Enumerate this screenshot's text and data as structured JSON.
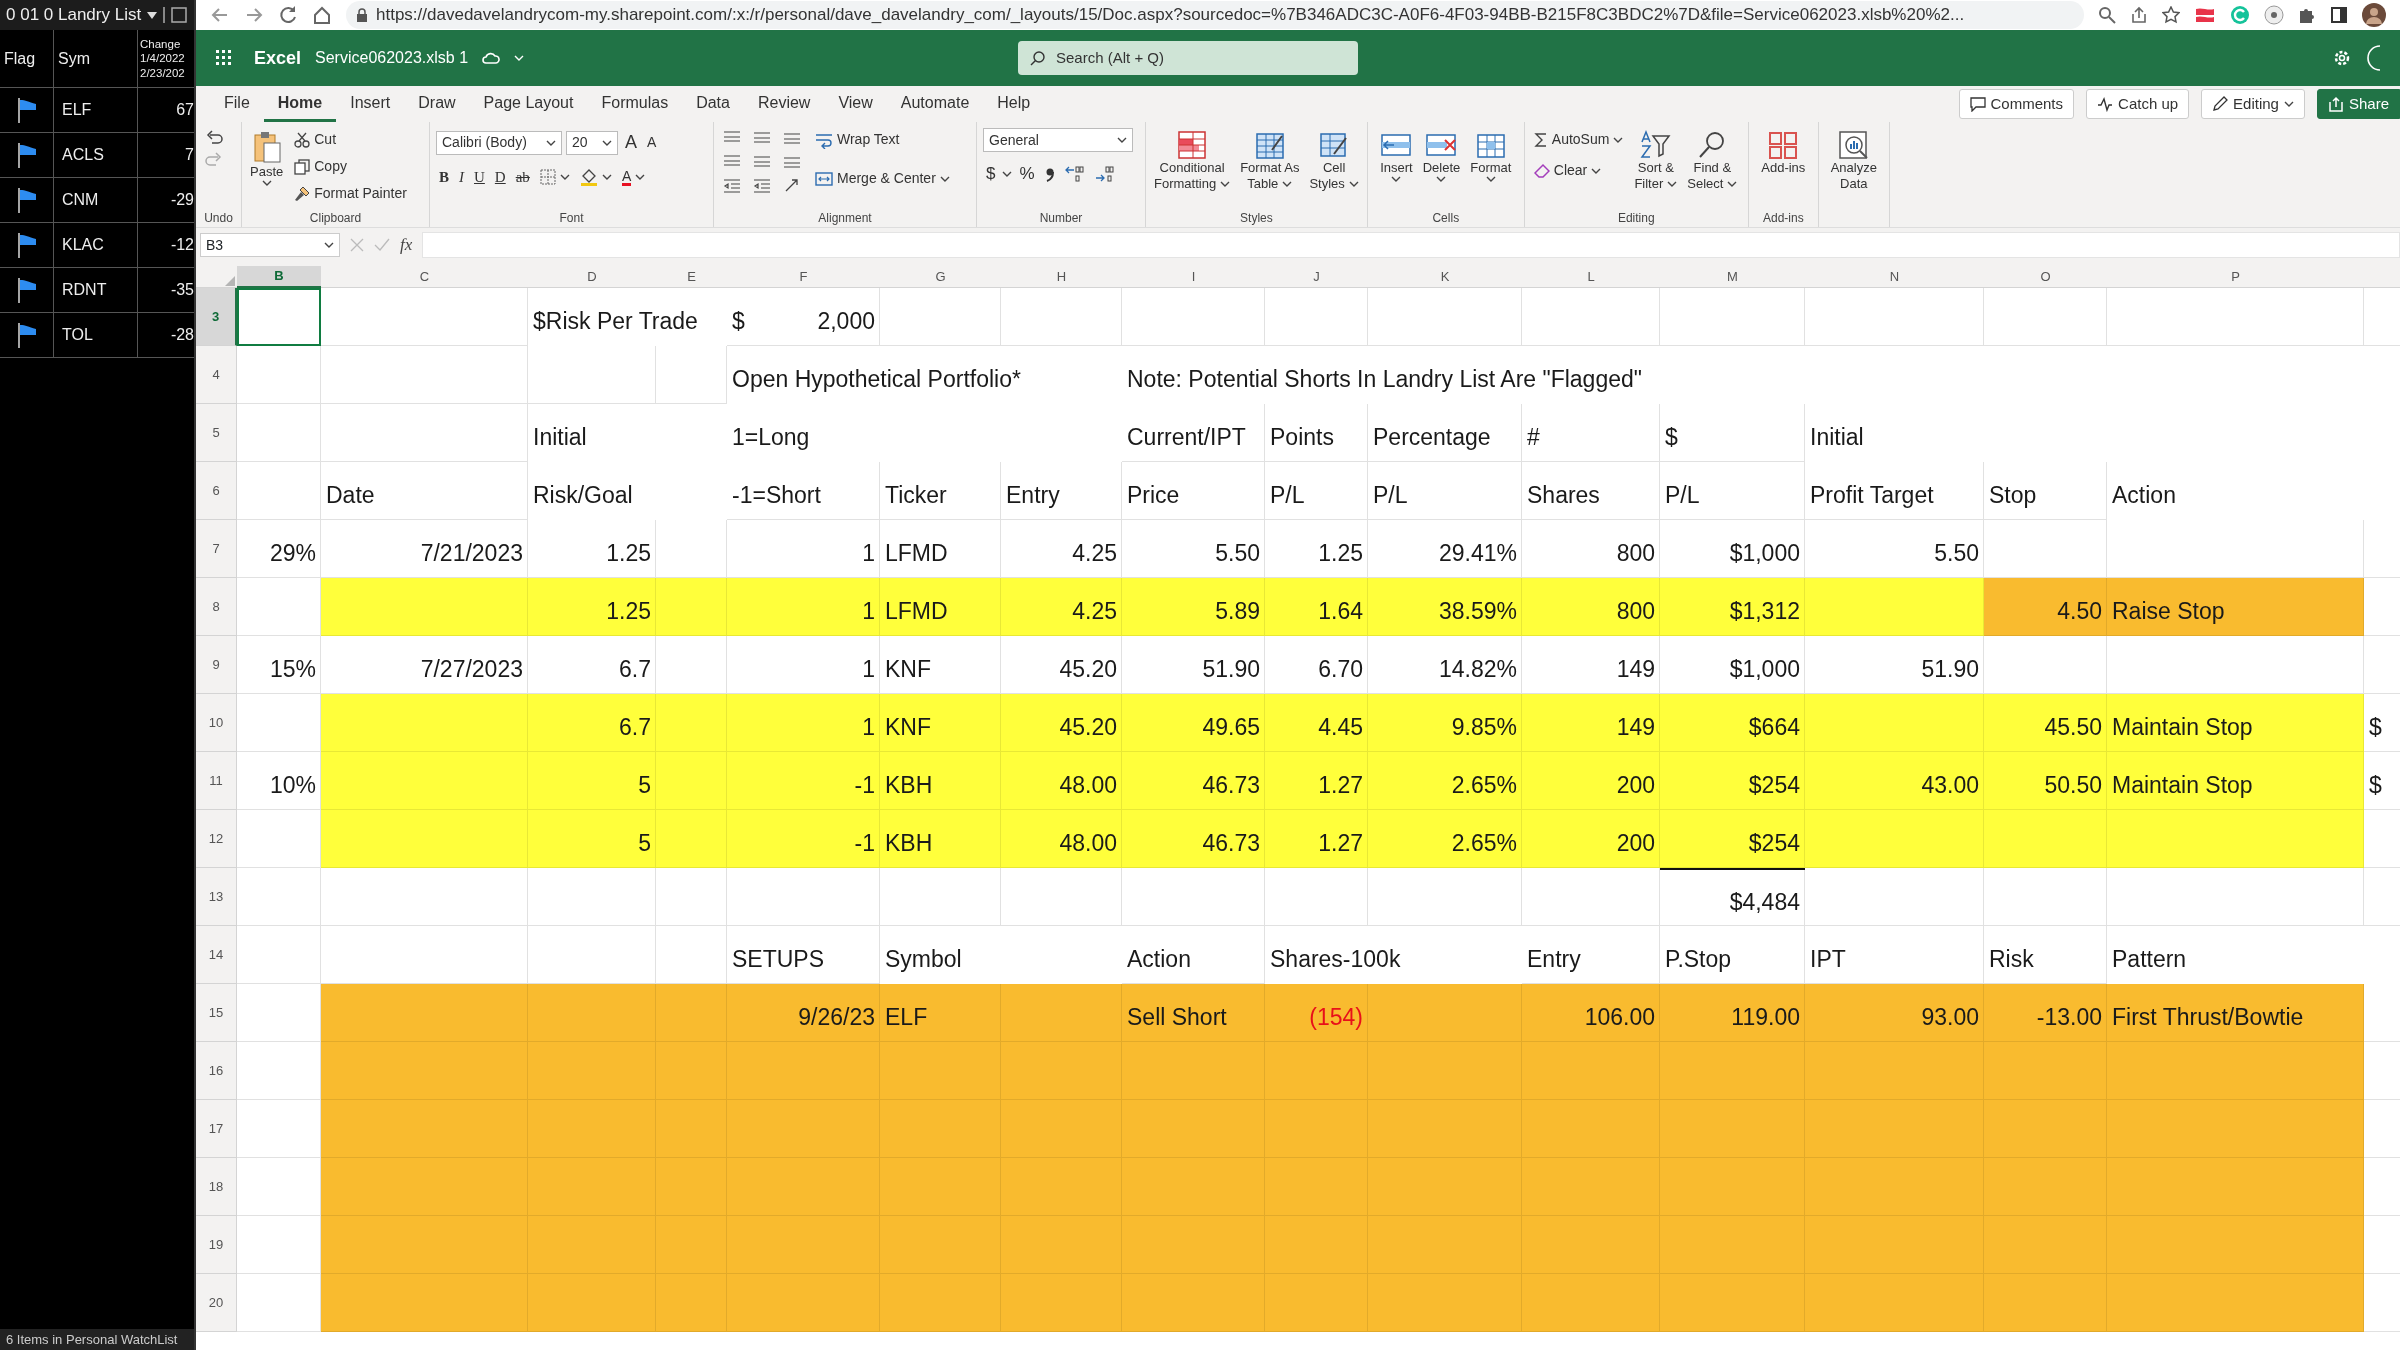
{
  "watchlist": {
    "title": "0 01 0 Landry List",
    "columns": [
      "Flag",
      "Sym"
    ],
    "change_header": [
      "Change",
      "1/4/2022",
      "2/23/202"
    ],
    "rows": [
      {
        "flagged": true,
        "symbol": "ELF",
        "change": "67"
      },
      {
        "flagged": true,
        "symbol": "ACLS",
        "change": "7"
      },
      {
        "flagged": true,
        "symbol": "CNM",
        "change": "-29"
      },
      {
        "flagged": true,
        "symbol": "KLAC",
        "change": "-12"
      },
      {
        "flagged": true,
        "symbol": "RDNT",
        "change": "-35"
      },
      {
        "flagged": true,
        "symbol": "TOL",
        "change": "-28"
      }
    ],
    "footer": "6 Items in Personal WatchList"
  },
  "browser": {
    "url": "https://davedavelandrycom-my.sharepoint.com/:x:/r/personal/dave_davelandry_com/_layouts/15/Doc.aspx?sourcedoc=%7B346ADC3C-A0F6-4F03-94BB-B215F8C3BDC2%7D&file=Service062023.xlsb%20%2..."
  },
  "app": {
    "name": "Excel",
    "file": "Service062023.xlsb 1",
    "search_placeholder": "Search (Alt + Q)"
  },
  "tabs": [
    {
      "label": "File",
      "selected": false
    },
    {
      "label": "Home",
      "selected": true
    },
    {
      "label": "Insert",
      "selected": false
    },
    {
      "label": "Draw",
      "selected": false
    },
    {
      "label": "Page Layout",
      "selected": false
    },
    {
      "label": "Formulas",
      "selected": false
    },
    {
      "label": "Data",
      "selected": false
    },
    {
      "label": "Review",
      "selected": false
    },
    {
      "label": "View",
      "selected": false
    },
    {
      "label": "Automate",
      "selected": false
    },
    {
      "label": "Help",
      "selected": false
    }
  ],
  "header_buttons": [
    {
      "label": "Comments",
      "kind": "comments"
    },
    {
      "label": "Catch up",
      "kind": "catchup"
    },
    {
      "label": "Editing",
      "kind": "editing"
    },
    {
      "label": "Share",
      "kind": "share"
    }
  ],
  "ribbon": [
    {
      "kind": "undo",
      "label": "Undo"
    },
    {
      "kind": "clipboard",
      "label": "Clipboard",
      "paste": "Paste",
      "cut": "Cut",
      "copy": "Copy",
      "painter": "Format Painter"
    },
    {
      "kind": "font",
      "label": "Font",
      "family": "Calibri (Body)",
      "size": "20",
      "grow": "A",
      "shrink": "A",
      "styles": [
        "B",
        "I",
        "U",
        "D",
        "ab"
      ],
      "color_letter": "A"
    },
    {
      "kind": "alignment",
      "label": "Alignment",
      "wrap": "Wrap Text",
      "merge": "Merge & Center"
    },
    {
      "kind": "number",
      "label": "Number",
      "format": "General",
      "symbols": [
        "$",
        "%"
      ]
    },
    {
      "kind": "styles",
      "label": "Styles",
      "buttons": [
        [
          "Conditional",
          "Formatting"
        ],
        [
          "Format As",
          "Table"
        ],
        [
          "Cell",
          "Styles"
        ]
      ]
    },
    {
      "kind": "cells",
      "label": "Cells",
      "buttons": [
        "Insert",
        "Delete",
        "Format"
      ]
    },
    {
      "kind": "editing",
      "label": "Editing",
      "autosum": "AutoSum",
      "clear": "Clear",
      "buttons": [
        [
          "Sort &",
          "Filter"
        ],
        [
          "Find &",
          "Select"
        ]
      ]
    },
    {
      "kind": "addins",
      "label": "Add-ins",
      "buttons": [
        [
          "Add-ins"
        ]
      ]
    },
    {
      "kind": "analyze",
      "buttons": [
        [
          "Analyze",
          "Data"
        ]
      ]
    }
  ],
  "formula_bar": {
    "name_box": "B3",
    "fx": "fx"
  },
  "sheet": {
    "columns": [
      {
        "label": "B",
        "selected": true
      },
      {
        "label": "C",
        "selected": false
      },
      {
        "label": "D",
        "selected": false
      },
      {
        "label": "E",
        "selected": false
      },
      {
        "label": "F",
        "selected": false
      },
      {
        "label": "G",
        "selected": false
      },
      {
        "label": "H",
        "selected": false
      },
      {
        "label": "I",
        "selected": false
      },
      {
        "label": "J",
        "selected": false
      },
      {
        "label": "K",
        "selected": false
      },
      {
        "label": "L",
        "selected": false
      },
      {
        "label": "M",
        "selected": false
      },
      {
        "label": "N",
        "selected": false
      },
      {
        "label": "O",
        "selected": false
      },
      {
        "label": "P",
        "selected": false
      },
      {
        "selected": false
      }
    ],
    "rows": [
      {
        "number": "3",
        "selected": true,
        "cells": [
          null,
          null,
          {
            "text": "$Risk Per Trade",
            "kind": "text"
          },
          null,
          {
            "kind": "accounting",
            "symbol": "$",
            "text": "2,000"
          },
          null,
          null,
          null,
          null,
          null,
          null,
          null,
          null,
          null,
          null,
          null
        ]
      },
      {
        "number": "4",
        "selected": false,
        "cells": [
          null,
          null,
          null,
          null,
          {
            "text": "Open Hypothetical Portfolio*",
            "kind": "text"
          },
          null,
          null,
          {
            "text": "Note: Potential Shorts In Landry List Are \"Flagged\"",
            "kind": "text"
          },
          null,
          null,
          null,
          null,
          null,
          null,
          null,
          null
        ]
      },
      {
        "number": "5",
        "selected": false,
        "cells": [
          null,
          null,
          {
            "text": "Initial",
            "kind": "text"
          },
          null,
          {
            "text": "1=Long",
            "kind": "text"
          },
          null,
          null,
          {
            "text": "Current/IPT",
            "kind": "text"
          },
          {
            "text": "Points",
            "kind": "text"
          },
          {
            "text": "Percentage",
            "kind": "text"
          },
          {
            "text": "#",
            "kind": "text"
          },
          {
            "text": "$",
            "kind": "text"
          },
          {
            "text": "Initial",
            "kind": "text"
          },
          null,
          null,
          null
        ]
      },
      {
        "number": "6",
        "selected": false,
        "cells": [
          null,
          {
            "text": "Date",
            "kind": "text"
          },
          {
            "text": "Risk/Goal",
            "kind": "text"
          },
          null,
          {
            "text": "-1=Short",
            "kind": "text"
          },
          {
            "text": "Ticker",
            "kind": "text"
          },
          {
            "text": "Entry",
            "kind": "text"
          },
          {
            "text": "Price",
            "kind": "text"
          },
          {
            "text": "P/L",
            "kind": "text"
          },
          {
            "text": "P/L",
            "kind": "text"
          },
          {
            "text": "Shares",
            "kind": "text"
          },
          {
            "text": "P/L",
            "kind": "text"
          },
          {
            "text": "Profit Target",
            "kind": "text"
          },
          {
            "text": "Stop",
            "kind": "text"
          },
          {
            "text": "Action",
            "kind": "text"
          },
          null
        ]
      },
      {
        "number": "7",
        "selected": false,
        "cells": [
          {
            "text": "29%",
            "kind": "number"
          },
          {
            "text": "7/21/2023",
            "kind": "number"
          },
          {
            "text": "1.25",
            "kind": "number"
          },
          null,
          {
            "text": "1",
            "kind": "number"
          },
          {
            "text": "LFMD",
            "kind": "text"
          },
          {
            "text": "4.25",
            "kind": "number"
          },
          {
            "text": "5.50",
            "kind": "number"
          },
          {
            "text": "1.25",
            "kind": "number"
          },
          {
            "text": "29.41%",
            "kind": "number"
          },
          {
            "text": "800",
            "kind": "number"
          },
          {
            "text": "$1,000",
            "kind": "number"
          },
          {
            "text": "5.50",
            "kind": "number"
          },
          null,
          null,
          null
        ]
      },
      {
        "number": "8",
        "selected": false,
        "cells": [
          null,
          {
            "color": "#ffff3b"
          },
          {
            "text": "1.25",
            "kind": "number",
            "color": "#ffff3b"
          },
          {
            "color": "#ffff3b"
          },
          {
            "text": "1",
            "kind": "number",
            "color": "#ffff3b"
          },
          {
            "text": "LFMD",
            "kind": "text",
            "color": "#ffff3b"
          },
          {
            "text": "4.25",
            "kind": "number",
            "color": "#ffff3b"
          },
          {
            "text": "5.89",
            "kind": "number",
            "color": "#ffff3b"
          },
          {
            "text": "1.64",
            "kind": "number",
            "color": "#ffff3b"
          },
          {
            "text": "38.59%",
            "kind": "number",
            "color": "#ffff3b"
          },
          {
            "text": "800",
            "kind": "number",
            "color": "#ffff3b"
          },
          {
            "text": "$1,312",
            "kind": "number",
            "color": "#ffff3b"
          },
          {
            "color": "#ffff3b"
          },
          {
            "text": "4.50",
            "kind": "number",
            "color": "#f9bb2f"
          },
          {
            "text": "Raise Stop",
            "kind": "text",
            "color": "#f9bb2f"
          },
          null
        ]
      },
      {
        "number": "9",
        "selected": false,
        "cells": [
          {
            "text": "15%",
            "kind": "number"
          },
          {
            "text": "7/27/2023",
            "kind": "number"
          },
          {
            "text": "6.7",
            "kind": "number"
          },
          null,
          {
            "text": "1",
            "kind": "number"
          },
          {
            "text": "KNF",
            "kind": "text"
          },
          {
            "text": "45.20",
            "kind": "number"
          },
          {
            "text": "51.90",
            "kind": "number"
          },
          {
            "text": "6.70",
            "kind": "number"
          },
          {
            "text": "14.82%",
            "kind": "number"
          },
          {
            "text": "149",
            "kind": "number"
          },
          {
            "text": "$1,000",
            "kind": "number"
          },
          {
            "text": "51.90",
            "kind": "number"
          },
          null,
          null,
          null
        ]
      },
      {
        "number": "10",
        "selected": false,
        "cells": [
          null,
          {
            "color": "#ffff3b"
          },
          {
            "text": "6.7",
            "kind": "number",
            "color": "#ffff3b"
          },
          {
            "color": "#ffff3b"
          },
          {
            "text": "1",
            "kind": "number",
            "color": "#ffff3b"
          },
          {
            "text": "KNF",
            "kind": "text",
            "color": "#ffff3b"
          },
          {
            "text": "45.20",
            "kind": "number",
            "color": "#ffff3b"
          },
          {
            "text": "49.65",
            "kind": "number",
            "color": "#ffff3b"
          },
          {
            "text": "4.45",
            "kind": "number",
            "color": "#ffff3b"
          },
          {
            "text": "9.85%",
            "kind": "number",
            "color": "#ffff3b"
          },
          {
            "text": "149",
            "kind": "number",
            "color": "#ffff3b"
          },
          {
            "text": "$664",
            "kind": "number",
            "color": "#ffff3b"
          },
          {
            "color": "#ffff3b"
          },
          {
            "text": "45.50",
            "kind": "number",
            "color": "#ffff3b"
          },
          {
            "text": "Maintain Stop",
            "kind": "text",
            "color": "#ffff3b"
          },
          {
            "text": "$",
            "kind": "text"
          }
        ]
      },
      {
        "number": "11",
        "selected": false,
        "cells": [
          {
            "text": "10%",
            "kind": "number"
          },
          {
            "color": "#ffff3b"
          },
          {
            "text": "5",
            "kind": "number",
            "color": "#ffff3b"
          },
          {
            "color": "#ffff3b"
          },
          {
            "text": "-1",
            "kind": "number",
            "color": "#ffff3b"
          },
          {
            "text": "KBH",
            "kind": "text",
            "color": "#ffff3b"
          },
          {
            "text": "48.00",
            "kind": "number",
            "color": "#ffff3b"
          },
          {
            "text": "46.73",
            "kind": "number",
            "color": "#ffff3b"
          },
          {
            "text": "1.27",
            "kind": "number",
            "color": "#ffff3b"
          },
          {
            "text": "2.65%",
            "kind": "number",
            "color": "#ffff3b"
          },
          {
            "text": "200",
            "kind": "number",
            "color": "#ffff3b"
          },
          {
            "text": "$254",
            "kind": "number",
            "color": "#ffff3b"
          },
          {
            "text": "43.00",
            "kind": "number",
            "color": "#ffff3b"
          },
          {
            "text": "50.50",
            "kind": "number",
            "color": "#ffff3b"
          },
          {
            "text": "Maintain Stop",
            "kind": "text",
            "color": "#ffff3b"
          },
          {
            "text": "$",
            "kind": "text"
          }
        ]
      },
      {
        "number": "12",
        "selected": false,
        "cells": [
          null,
          {
            "color": "#ffff3b"
          },
          {
            "text": "5",
            "kind": "number",
            "color": "#ffff3b"
          },
          {
            "color": "#ffff3b"
          },
          {
            "text": "-1",
            "kind": "number",
            "color": "#ffff3b"
          },
          {
            "text": "KBH",
            "kind": "text",
            "color": "#ffff3b"
          },
          {
            "text": "48.00",
            "kind": "number",
            "color": "#ffff3b"
          },
          {
            "text": "46.73",
            "kind": "number",
            "color": "#ffff3b"
          },
          {
            "text": "1.27",
            "kind": "number",
            "color": "#ffff3b"
          },
          {
            "text": "2.65%",
            "kind": "number",
            "color": "#ffff3b"
          },
          {
            "text": "200",
            "kind": "number",
            "color": "#ffff3b"
          },
          {
            "text": "$254",
            "kind": "number",
            "color": "#ffff3b"
          },
          {
            "color": "#ffff3b"
          },
          {
            "color": "#ffff3b"
          },
          {
            "color": "#ffff3b"
          },
          null
        ]
      },
      {
        "number": "13",
        "selected": false,
        "cells": [
          null,
          null,
          null,
          null,
          null,
          null,
          null,
          null,
          null,
          null,
          null,
          {
            "text": "$4,484",
            "kind": "number",
            "border_top": true
          },
          null,
          null,
          null,
          null
        ]
      },
      {
        "number": "14",
        "selected": false,
        "cells": [
          null,
          null,
          null,
          null,
          {
            "text": "SETUPS",
            "kind": "text"
          },
          {
            "text": "Symbol",
            "kind": "text"
          },
          null,
          {
            "text": "Action",
            "kind": "text"
          },
          {
            "text": "Shares-100k",
            "kind": "text"
          },
          null,
          {
            "text": "Entry",
            "kind": "text"
          },
          {
            "text": "P.Stop",
            "kind": "text"
          },
          {
            "text": "IPT",
            "kind": "text"
          },
          {
            "text": "Risk",
            "kind": "text"
          },
          {
            "text": "Pattern",
            "kind": "text"
          },
          null
        ]
      },
      {
        "number": "15",
        "selected": false,
        "cells": [
          null,
          {
            "color": "#f9bb2f"
          },
          {
            "color": "#f9bb2f"
          },
          {
            "color": "#f9bb2f"
          },
          {
            "text": "9/26/23",
            "kind": "number",
            "color": "#f9bb2f"
          },
          {
            "text": "ELF",
            "kind": "text",
            "color": "#f9bb2f"
          },
          {
            "color": "#f9bb2f"
          },
          {
            "text": "Sell Short",
            "kind": "text",
            "color": "#f9bb2f"
          },
          {
            "text": "(154)",
            "kind": "number",
            "color": "#f9bb2f",
            "negative": true
          },
          {
            "color": "#f9bb2f"
          },
          {
            "text": "106.00",
            "kind": "number",
            "color": "#f9bb2f"
          },
          {
            "text": "119.00",
            "kind": "number",
            "color": "#f9bb2f"
          },
          {
            "text": "93.00",
            "kind": "number",
            "color": "#f9bb2f"
          },
          {
            "text": "-13.00",
            "kind": "number",
            "color": "#f9bb2f"
          },
          {
            "text": "First Thrust/Bowtie",
            "kind": "text",
            "color": "#f9bb2f"
          },
          null
        ]
      },
      {
        "number": "16",
        "selected": false,
        "cells": [
          null,
          {
            "color": "#f9bb2f"
          },
          {
            "color": "#f9bb2f"
          },
          {
            "color": "#f9bb2f"
          },
          {
            "color": "#f9bb2f"
          },
          {
            "color": "#f9bb2f"
          },
          {
            "color": "#f9bb2f"
          },
          {
            "color": "#f9bb2f"
          },
          {
            "color": "#f9bb2f"
          },
          {
            "color": "#f9bb2f"
          },
          {
            "color": "#f9bb2f"
          },
          {
            "color": "#f9bb2f"
          },
          {
            "color": "#f9bb2f"
          },
          {
            "color": "#f9bb2f"
          },
          {
            "color": "#f9bb2f"
          },
          null
        ]
      },
      {
        "number": "17",
        "selected": false,
        "cells": [
          null,
          {
            "color": "#f9bb2f"
          },
          {
            "color": "#f9bb2f"
          },
          {
            "color": "#f9bb2f"
          },
          {
            "color": "#f9bb2f"
          },
          {
            "color": "#f9bb2f"
          },
          {
            "color": "#f9bb2f"
          },
          {
            "color": "#f9bb2f"
          },
          {
            "color": "#f9bb2f"
          },
          {
            "color": "#f9bb2f"
          },
          {
            "color": "#f9bb2f"
          },
          {
            "color": "#f9bb2f"
          },
          {
            "color": "#f9bb2f"
          },
          {
            "color": "#f9bb2f"
          },
          {
            "color": "#f9bb2f"
          },
          null
        ]
      },
      {
        "number": "18",
        "selected": false,
        "cells": [
          null,
          {
            "color": "#f9bb2f"
          },
          {
            "color": "#f9bb2f"
          },
          {
            "color": "#f9bb2f"
          },
          {
            "color": "#f9bb2f"
          },
          {
            "color": "#f9bb2f"
          },
          {
            "color": "#f9bb2f"
          },
          {
            "color": "#f9bb2f"
          },
          {
            "color": "#f9bb2f"
          },
          {
            "color": "#f9bb2f"
          },
          {
            "color": "#f9bb2f"
          },
          {
            "color": "#f9bb2f"
          },
          {
            "color": "#f9bb2f"
          },
          {
            "color": "#f9bb2f"
          },
          {
            "color": "#f9bb2f"
          },
          null
        ]
      },
      {
        "number": "19",
        "selected": false,
        "cells": [
          null,
          {
            "color": "#f9bb2f"
          },
          {
            "color": "#f9bb2f"
          },
          {
            "color": "#f9bb2f"
          },
          {
            "color": "#f9bb2f"
          },
          {
            "color": "#f9bb2f"
          },
          {
            "color": "#f9bb2f"
          },
          {
            "color": "#f9bb2f"
          },
          {
            "color": "#f9bb2f"
          },
          {
            "color": "#f9bb2f"
          },
          {
            "color": "#f9bb2f"
          },
          {
            "color": "#f9bb2f"
          },
          {
            "color": "#f9bb2f"
          },
          {
            "color": "#f9bb2f"
          },
          {
            "color": "#f9bb2f"
          },
          null
        ]
      },
      {
        "number": "20",
        "selected": false,
        "cells": [
          null,
          {
            "color": "#f9bb2f"
          },
          {
            "color": "#f9bb2f"
          },
          {
            "color": "#f9bb2f"
          },
          {
            "color": "#f9bb2f"
          },
          {
            "color": "#f9bb2f"
          },
          {
            "color": "#f9bb2f"
          },
          {
            "color": "#f9bb2f"
          },
          {
            "color": "#f9bb2f"
          },
          {
            "color": "#f9bb2f"
          },
          {
            "color": "#f9bb2f"
          },
          {
            "color": "#f9bb2f"
          },
          {
            "color": "#f9bb2f"
          },
          {
            "color": "#f9bb2f"
          },
          {
            "color": "#f9bb2f"
          },
          null
        ]
      }
    ]
  }
}
